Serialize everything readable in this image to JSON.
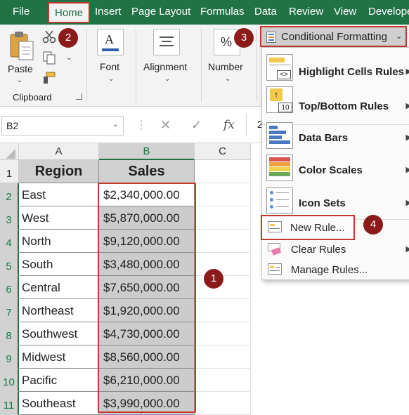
{
  "ribbon_tabs": [
    "File",
    "Home",
    "Insert",
    "Page Layout",
    "Formulas",
    "Data",
    "Review",
    "View",
    "Developer"
  ],
  "ribbon": {
    "paste_label": "Paste",
    "clipboard_label": "Clipboard",
    "font_label": "Font",
    "alignment_label": "Alignment",
    "number_label": "Number",
    "percent_glyph": "%"
  },
  "formula_bar": {
    "name_box": "B2",
    "fx": "fx",
    "formula_fragment": "2"
  },
  "grid": {
    "columns": [
      "A",
      "B",
      "C"
    ],
    "rows": [
      "1",
      "2",
      "3",
      "4",
      "5",
      "6",
      "7",
      "8",
      "9",
      "10",
      "11"
    ],
    "headers": {
      "region": "Region",
      "sales": "Sales"
    },
    "records": [
      {
        "region": "East",
        "sales": "$2,340,000.00"
      },
      {
        "region": "West",
        "sales": "$5,870,000.00"
      },
      {
        "region": "North",
        "sales": "$9,120,000.00"
      },
      {
        "region": "South",
        "sales": "$3,480,000.00"
      },
      {
        "region": "Central",
        "sales": "$7,650,000.00"
      },
      {
        "region": "Northeast",
        "sales": "$1,920,000.00"
      },
      {
        "region": "Southwest",
        "sales": "$4,730,000.00"
      },
      {
        "region": "Midwest",
        "sales": "$8,560,000.00"
      },
      {
        "region": "Pacific",
        "sales": "$6,210,000.00"
      },
      {
        "region": "Southeast",
        "sales": "$3,990,000.00"
      }
    ]
  },
  "conditional_formatting": {
    "button_label": "Conditional Formatting",
    "menu": [
      {
        "label": "Highlight Cells Rules",
        "icon": "highlight-cells-icon",
        "submenu": true
      },
      {
        "label": "Top/Bottom Rules",
        "icon": "top-bottom-icon",
        "submenu": true
      },
      {
        "label": "Data Bars",
        "icon": "data-bars-icon",
        "submenu": true
      },
      {
        "label": "Color Scales",
        "icon": "color-scales-icon",
        "submenu": true
      },
      {
        "label": "Icon Sets",
        "icon": "icon-sets-icon",
        "submenu": true
      },
      {
        "label": "New Rule...",
        "icon": "new-rule-icon",
        "submenu": false
      },
      {
        "label": "Clear Rules",
        "icon": "clear-rules-icon",
        "submenu": true
      },
      {
        "label": "Manage Rules...",
        "icon": "manage-rules-icon",
        "submenu": false
      }
    ]
  },
  "badges": [
    "1",
    "2",
    "3",
    "4"
  ],
  "colors": {
    "excel_green": "#217346",
    "highlight_red": "#c0392b",
    "badge": "#8b1a1a",
    "selection_fill": "#cccccc"
  }
}
